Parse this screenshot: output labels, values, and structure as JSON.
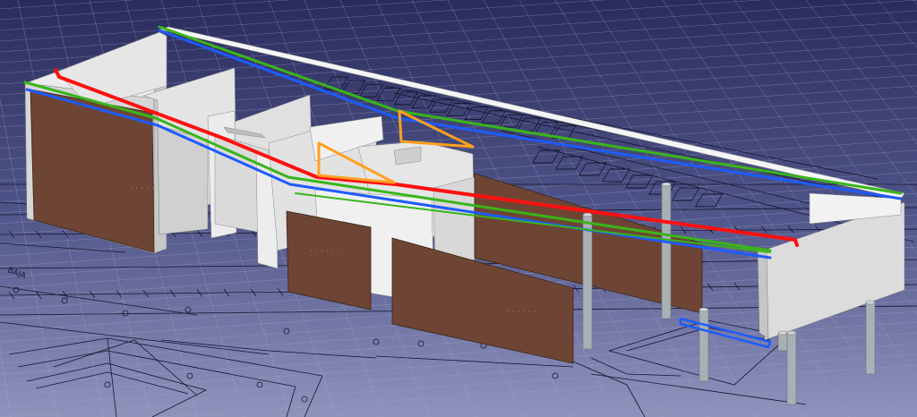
{
  "window": {
    "title": ""
  },
  "scene": {
    "plan_label": "BAJA",
    "colors": {
      "background_top": "#2a2c5c",
      "background_bottom": "#8f93bc",
      "grid_line": "#a8acd4",
      "plan_line": "#14152e",
      "wall_light": "#e2e2e2",
      "wall_side": "#c4c4c4",
      "wall_top": "#f5f5f5",
      "wall_brown": "#6e4534",
      "column": "#a9b0b6",
      "edge_red": "#ff1010",
      "edge_green": "#39b51a",
      "edge_blue": "#1e5bff",
      "edge_orange": "#ffa020"
    },
    "wall_labels": [
      "· · · · · · ·",
      "· · · · · ·",
      "· · · · · ·",
      "· · · · · ·",
      "· · · · · ·"
    ]
  }
}
